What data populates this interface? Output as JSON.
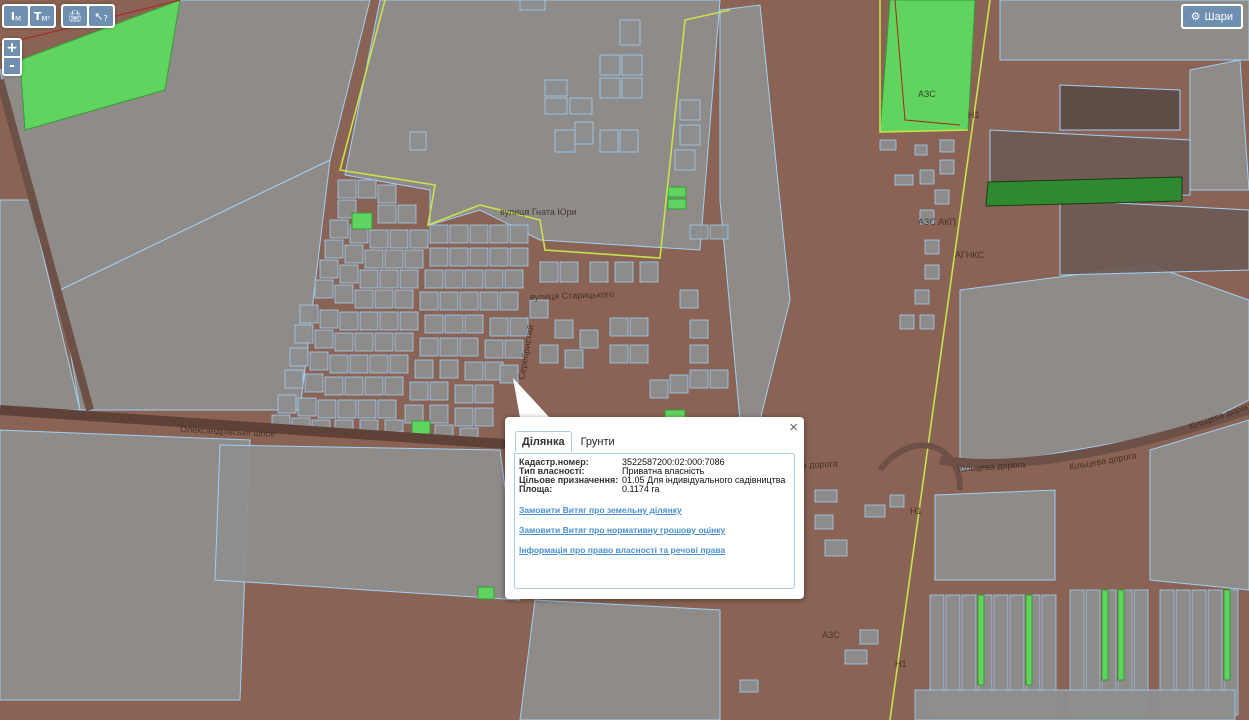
{
  "toolbar": {
    "measure_length_label": "М",
    "measure_area_label": "М²",
    "print_label": "🖨",
    "info_label": "?"
  },
  "zoom": {
    "in_label": "+",
    "out_label": "-"
  },
  "layers_button": {
    "label": "Шари"
  },
  "map_labels": {
    "street_1": "Олександрівське шосе",
    "street_2": "вулиця Старицького",
    "street_3": "вулиця Гната Юри",
    "street_4": "Кільцева дорога",
    "street_5": "Кільцева дорога",
    "street_6": "Кільцева дорога",
    "street_7": "Кільцева дорога",
    "street_8": "Серебристий",
    "poi_1": "АЗС",
    "poi_2": "АЗС АКП",
    "poi_3": "АГНКС",
    "poi_4": "АЗС",
    "road_1": "Н1",
    "road_2": "Н1",
    "road_3": "Н1"
  },
  "popup": {
    "close_label": "×",
    "tabs": [
      "Ділянка",
      "Грунти"
    ],
    "fields": [
      {
        "label": "Кадастр.номер:",
        "value": "3522587200:02:000:7086"
      },
      {
        "label": "Тип власності:",
        "value": "Приватна власність"
      },
      {
        "label": "Цільове призначення:",
        "value": "01.05 Для індивідуального садівництва"
      },
      {
        "label": "Площа:",
        "value": "0.1174 га"
      }
    ],
    "links": [
      "Замовити Витяг про земельну ділянку",
      "Замовити Витяг про нормативну грошову оцінку",
      "Інформація про право власності та речові права"
    ]
  },
  "colors": {
    "background": "#8b6354",
    "parcel_fill": "#8e8e8e",
    "parcel_stroke": "#9fd0f5",
    "green_parcel": "#5fd45f",
    "boundary": "#c8e24a",
    "control_blue": "#6f8fb1"
  }
}
